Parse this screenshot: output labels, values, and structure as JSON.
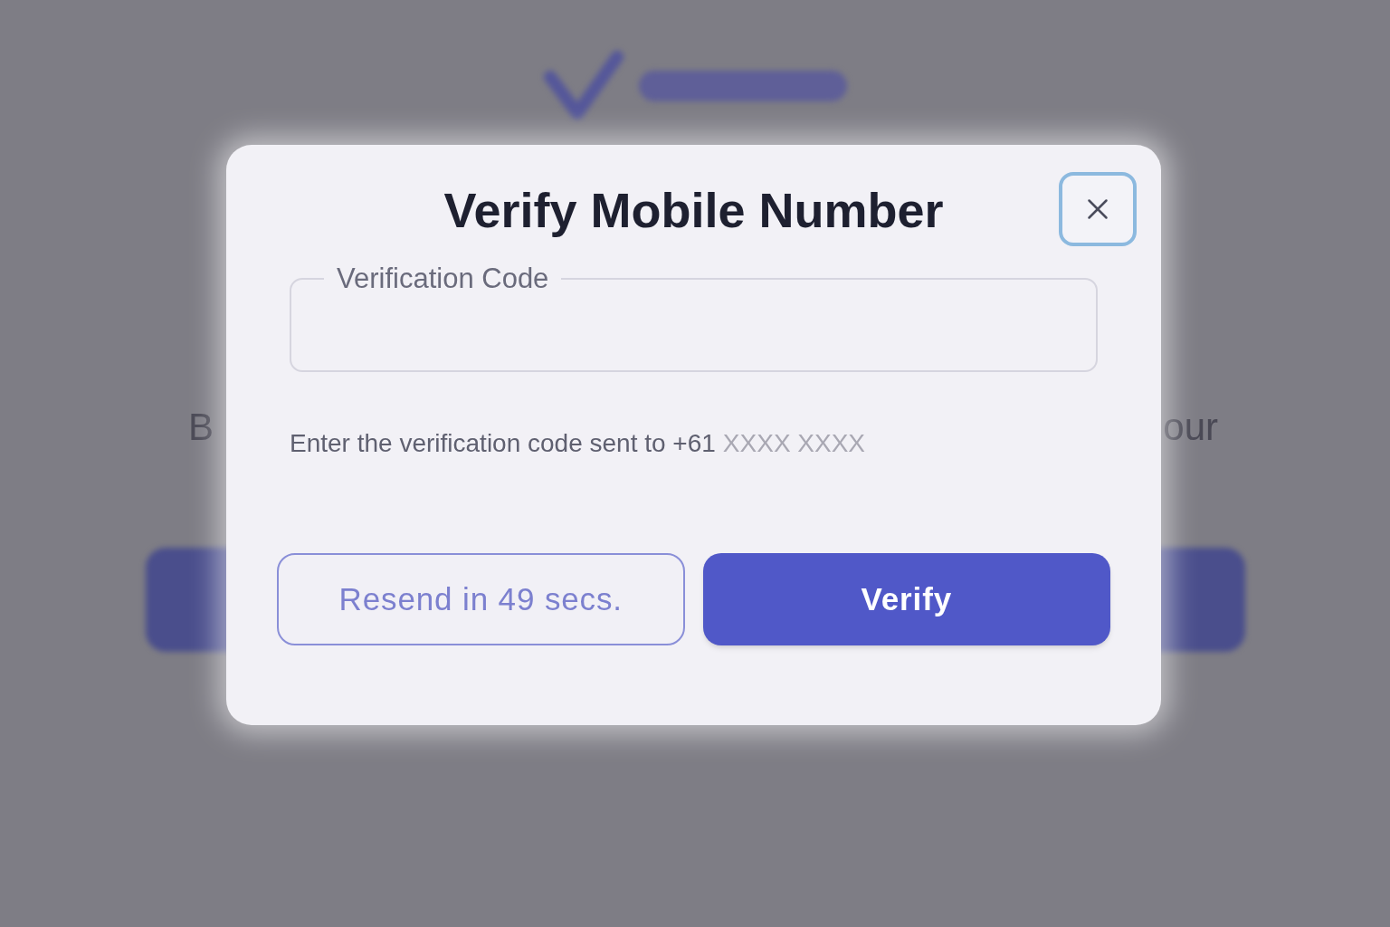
{
  "background": {
    "text_left": "B",
    "text_right": "our"
  },
  "dialog": {
    "title": "Verify Mobile Number",
    "field": {
      "label": "Verification Code"
    },
    "helper": {
      "text": "Enter the verification code sent to +61",
      "masked_number": "XXXX XXXX"
    },
    "buttons": [
      {
        "label": "Resend in 49 secs.",
        "kind": "outline"
      },
      {
        "label": "Verify",
        "kind": "primary"
      }
    ]
  }
}
